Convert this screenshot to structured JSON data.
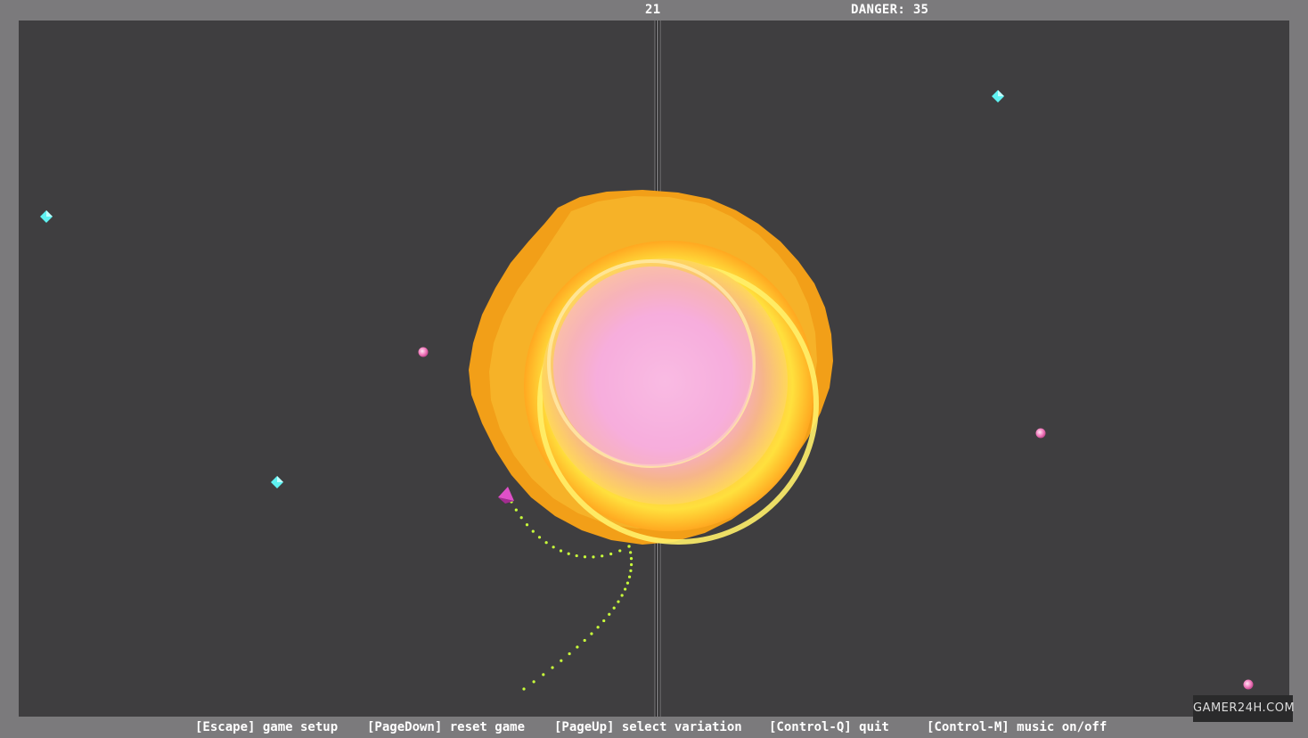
{
  "hud": {
    "score": "21",
    "danger": "DANGER: 35"
  },
  "footer": {
    "keys": [
      "[Escape] game setup",
      "[PageDown] reset game",
      "[PageUp] select variation",
      "[Control-Q] quit",
      "[Control-M] music on/off"
    ]
  },
  "watermark": "GAMER24H.COM",
  "colors": {
    "background": "#7b7a7c",
    "playfield": "#3f3e40",
    "sun_outer": "#f6a51a",
    "sun_glow": "#ffe24a",
    "sun_core": "#f7b6df",
    "crystal": "#5ff2f2",
    "orb": "#f38fc6",
    "ship": "#e050c8",
    "trail": "#c9ff3a"
  },
  "icons": {
    "sun": "sun-icon",
    "crystal": "crystal-icon",
    "orb": "orb-icon",
    "ship": "ship-icon"
  }
}
